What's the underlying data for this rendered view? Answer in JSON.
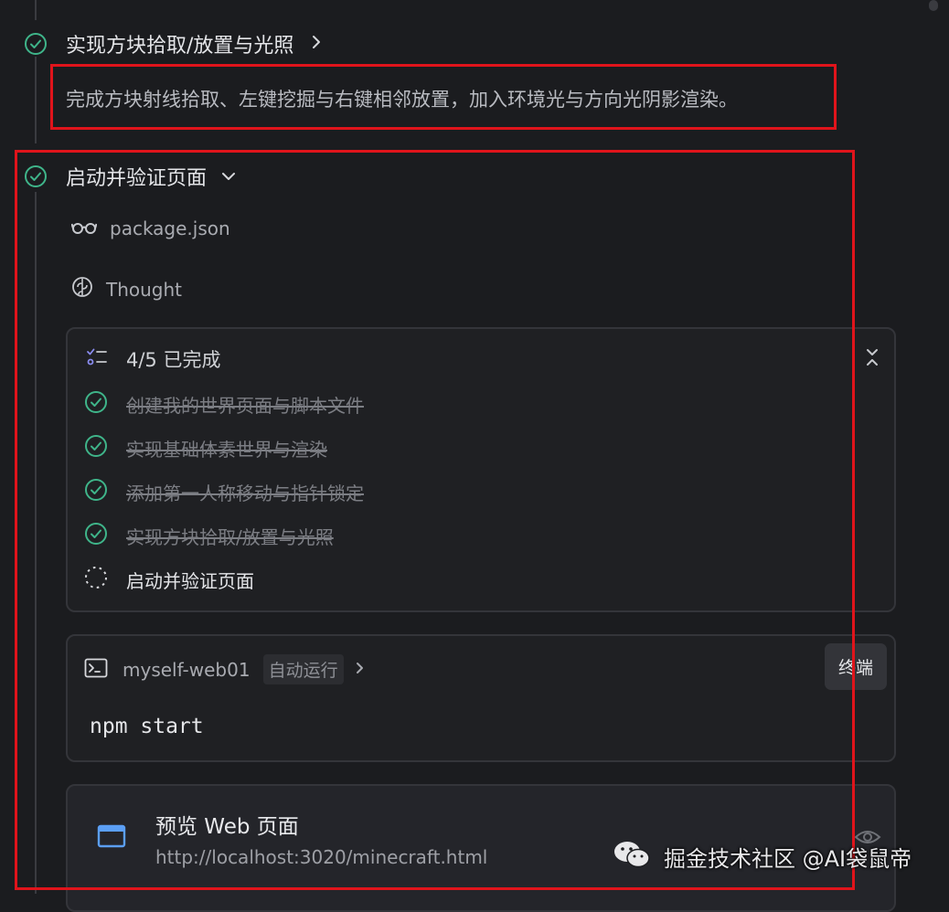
{
  "step_done": {
    "title": "实现方块拾取/放置与光照",
    "description": "完成方块射线拾取、左键挖掘与右键相邻放置，加入环境光与方向光阴影渲染。"
  },
  "step_active": {
    "title": "启动并验证页面",
    "read_file": "package.json",
    "thought": "Thought"
  },
  "todo": {
    "summary": "4/5 已完成",
    "items": [
      {
        "label": "创建我的世界页面与脚本文件",
        "done": true
      },
      {
        "label": "实现基础体素世界与渲染",
        "done": true
      },
      {
        "label": "添加第一人称移动与指针锁定",
        "done": true
      },
      {
        "label": "实现方块拾取/放置与光照",
        "done": true
      },
      {
        "label": "启动并验证页面",
        "done": false
      }
    ]
  },
  "terminal": {
    "project": "myself-web01",
    "mode": "自动运行",
    "button": "终端",
    "command": "npm start"
  },
  "preview": {
    "title": "预览 Web 页面",
    "url": "http://localhost:3020/minecraft.html"
  },
  "watermark": {
    "text": "掘金技术社区 @AI袋鼠帝"
  },
  "colors": {
    "success": "#3fb58a",
    "annotation": "#e0141b",
    "preview_icon": "#5b9ff5"
  }
}
